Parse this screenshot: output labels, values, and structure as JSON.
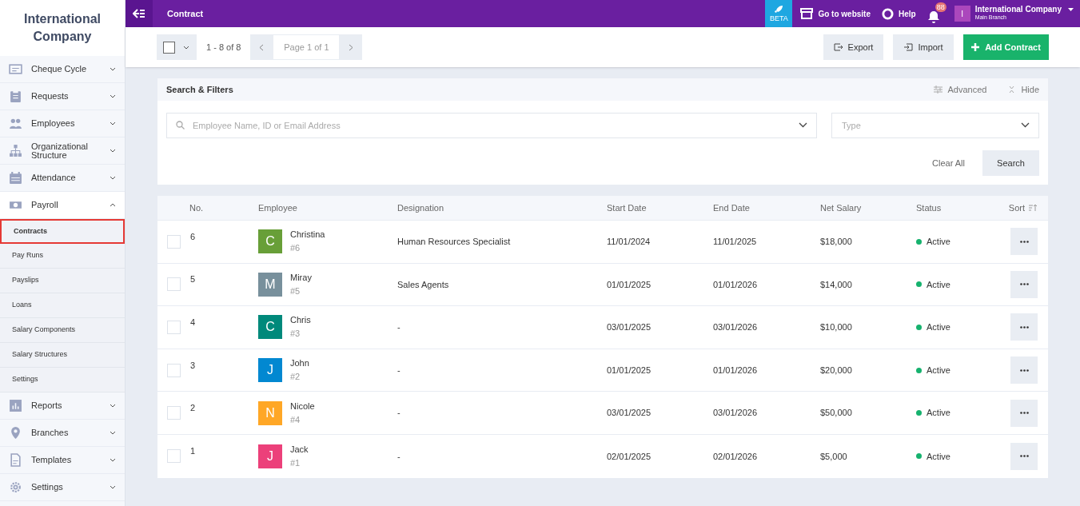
{
  "sidebar": {
    "company": "International Company",
    "items": [
      {
        "label": "Cheque Cycle",
        "expanded": false
      },
      {
        "label": "Requests",
        "expanded": false
      },
      {
        "label": "Employees",
        "expanded": false
      },
      {
        "label": "Organizational Structure",
        "expanded": false
      },
      {
        "label": "Attendance",
        "expanded": false
      },
      {
        "label": "Payroll",
        "expanded": true,
        "children": [
          {
            "label": "Contracts",
            "selected": true
          },
          {
            "label": "Pay Runs",
            "selected": false
          },
          {
            "label": "Payslips",
            "selected": false
          },
          {
            "label": "Loans",
            "selected": false
          },
          {
            "label": "Salary Components",
            "selected": false
          },
          {
            "label": "Salary Structures",
            "selected": false
          },
          {
            "label": "Settings",
            "selected": false
          }
        ]
      },
      {
        "label": "Reports",
        "expanded": false
      },
      {
        "label": "Branches",
        "expanded": false
      },
      {
        "label": "Templates",
        "expanded": false
      },
      {
        "label": "Settings",
        "expanded": false
      }
    ]
  },
  "topbar": {
    "title": "Contract",
    "beta": "BETA",
    "website": "Go to website",
    "help": "Help",
    "notifications": "88",
    "account": {
      "initial": "I",
      "name": "International Company",
      "branch": "Main Branch"
    }
  },
  "toolbar": {
    "select_all_checked": false,
    "range": "1 - 8 of 8",
    "page": "Page 1 of 1",
    "export": "Export",
    "import": "Import",
    "add": "Add Contract"
  },
  "filters": {
    "title": "Search & Filters",
    "advanced": "Advanced",
    "hide": "Hide",
    "search_placeholder": "Employee Name, ID or Email Address",
    "type_placeholder": "Type",
    "clear": "Clear All",
    "search": "Search"
  },
  "table": {
    "columns": [
      "No.",
      "Employee",
      "Designation",
      "Start Date",
      "End Date",
      "Net Salary",
      "Status",
      "Sort"
    ],
    "rows": [
      {
        "checked": false,
        "no": "6",
        "initial": "C",
        "color": "#689f38",
        "name": "Christina",
        "id": "#6",
        "designation": "Human Resources Specialist",
        "start": "11/01/2024",
        "end": "11/01/2025",
        "salary": "$18,000",
        "status": "Active"
      },
      {
        "checked": false,
        "no": "5",
        "initial": "M",
        "color": "#78909c",
        "name": "Miray",
        "id": "#5",
        "designation": "Sales Agents",
        "start": "01/01/2025",
        "end": "01/01/2026",
        "salary": "$14,000",
        "status": "Active"
      },
      {
        "checked": false,
        "no": "4",
        "initial": "C",
        "color": "#00897b",
        "name": "Chris",
        "id": "#3",
        "designation": "-",
        "start": "03/01/2025",
        "end": "03/01/2026",
        "salary": "$10,000",
        "status": "Active"
      },
      {
        "checked": false,
        "no": "3",
        "initial": "J",
        "color": "#0288d1",
        "name": "John",
        "id": "#2",
        "designation": "-",
        "start": "01/01/2025",
        "end": "01/01/2026",
        "salary": "$20,000",
        "status": "Active"
      },
      {
        "checked": false,
        "no": "2",
        "initial": "N",
        "color": "#ffa726",
        "name": "Nicole",
        "id": "#4",
        "designation": "-",
        "start": "03/01/2025",
        "end": "03/01/2026",
        "salary": "$50,000",
        "status": "Active"
      },
      {
        "checked": false,
        "no": "1",
        "initial": "J",
        "color": "#ec407a",
        "name": "Jack",
        "id": "#1",
        "designation": "-",
        "start": "02/01/2025",
        "end": "02/01/2026",
        "salary": "$5,000",
        "status": "Active"
      }
    ]
  }
}
